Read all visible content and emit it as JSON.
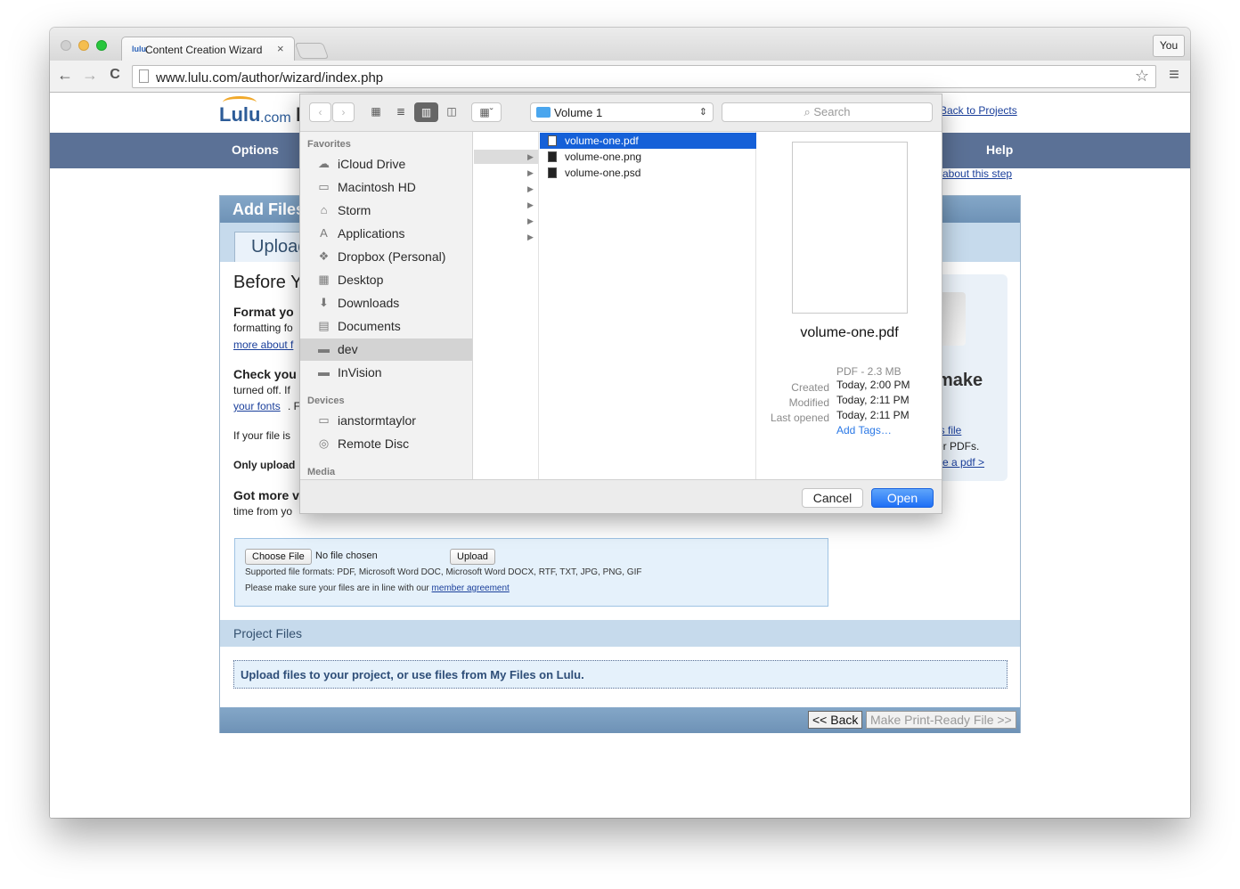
{
  "browser": {
    "tab_title": "Content Creation Wizard",
    "tab_close": "×",
    "profile_label": "You",
    "url": "www.lulu.com/author/wizard/index.php",
    "nav": {
      "back": "←",
      "forward": "→",
      "reload": "C",
      "bookmark": "☆",
      "menu": "≡"
    }
  },
  "lulu": {
    "logo_text": "Lulu",
    "logo_suffix": ".com",
    "header_initial": "P",
    "back_to_projects": "Back to Projects",
    "nav": {
      "options": "Options",
      "help": "Help"
    },
    "help_link": "about this step",
    "panel_title": "Add Files",
    "upload_tab": "Upload",
    "before_heading": "Before Y",
    "format_heading": "Format yo",
    "format_text": "formatting fo",
    "more_about": "more about f",
    "check_heading": "Check you",
    "check_text": "turned off. If",
    "your_fonts": "your fonts",
    "fonts_tail": ". F",
    "if_file": "If your file is",
    "only_upload": "Only upload",
    "got_more": "Got more v",
    "time_from": "time from yo",
    "adobe_make": "make",
    "this_file": "is file",
    "er_pdfs": "er PDFs.",
    "make_pdf": "ke a pdf >",
    "choose_file": "Choose File",
    "no_file": "No file chosen",
    "upload_btn": "Upload",
    "supported": "Supported file formats: PDF, Microsoft Word DOC, Microsoft Word DOCX, RTF, TXT, JPG, PNG, GIF",
    "member_pre": "Please make sure your files are in line with our ",
    "member_link": "member agreement",
    "project_files": "Project Files",
    "project_files_msg": "Upload files to your project, or use files from My Files on Lulu.",
    "back_btn": "<< Back",
    "print_ready_btn": "Make Print-Ready File >>"
  },
  "dialog": {
    "location": "Volume 1",
    "search_placeholder": "Search",
    "favorites_label": "Favorites",
    "favorites": [
      {
        "label": "iCloud Drive",
        "icon": "☁"
      },
      {
        "label": "Macintosh HD",
        "icon": "▭"
      },
      {
        "label": "Storm",
        "icon": "⌂"
      },
      {
        "label": "Applications",
        "icon": "A"
      },
      {
        "label": "Dropbox (Personal)",
        "icon": "❖"
      },
      {
        "label": "Desktop",
        "icon": "▦"
      },
      {
        "label": "Downloads",
        "icon": "⬇"
      },
      {
        "label": "Documents",
        "icon": "▤"
      },
      {
        "label": "dev",
        "icon": "▬"
      },
      {
        "label": "InVision",
        "icon": "▬"
      }
    ],
    "selected_favorite": "dev",
    "devices_label": "Devices",
    "devices": [
      {
        "label": "ianstormtaylor",
        "icon": "▭"
      },
      {
        "label": "Remote Disc",
        "icon": "◎"
      }
    ],
    "media_label": "Media",
    "files": [
      {
        "name": "volume-one.pdf",
        "selected": true
      },
      {
        "name": "volume-one.png",
        "selected": false
      },
      {
        "name": "volume-one.psd",
        "selected": false
      }
    ],
    "preview": {
      "name": "volume-one.pdf",
      "kind": "PDF - 2.3 MB",
      "created_label": "Created",
      "created": "Today, 2:00 PM",
      "modified_label": "Modified",
      "modified": "Today, 2:11 PM",
      "opened_label": "Last opened",
      "opened": "Today, 2:11 PM",
      "add_tags": "Add Tags…"
    },
    "cancel": "Cancel",
    "open": "Open"
  },
  "colors": {
    "nav_blue": "#5b7196",
    "accent": "#1e6ff5",
    "selection": "#1560d8"
  }
}
